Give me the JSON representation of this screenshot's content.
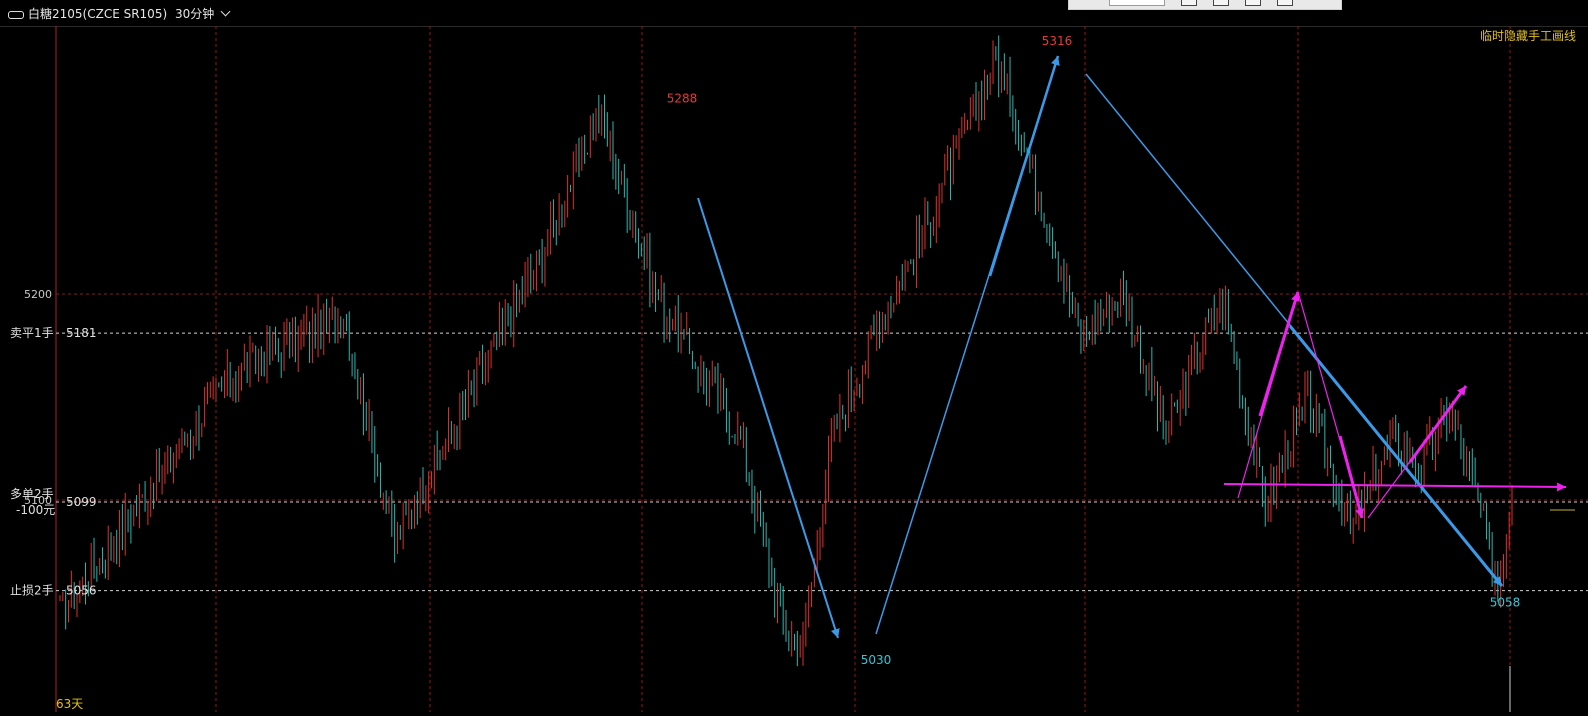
{
  "header": {
    "link_icon": "link-icon",
    "symbol": "白糖2105(CZCE SR105)",
    "period": "30分钟"
  },
  "toolbar_overlay": {
    "hide_lines_label": "临时隐藏手工画线"
  },
  "footer": {
    "days_label": "63天"
  },
  "colors": {
    "background": "#000000",
    "up": "#e0302c",
    "down": "#2ab7b0",
    "grid": "#8b1a1a",
    "guide": "#cfcfcf",
    "blue_line": "#3b9ae8",
    "magenta_line": "#ee22ee",
    "high_label": "#e23a3a",
    "low_label": "#31c7d9",
    "yellow": "#e0c020"
  },
  "chart_data": {
    "type": "candlestick",
    "ylim": [
      5010,
      5340
    ],
    "price_gridlines": [
      {
        "label": "5200",
        "value": 5200
      },
      {
        "label": "5100",
        "value": 5100
      }
    ],
    "order_lines": [
      {
        "label": "卖平1手",
        "price_label": "5181",
        "value": 5181
      },
      {
        "label": "多单2手\n-100元",
        "price_label": "5099",
        "value": 5099
      },
      {
        "label": "止损2手",
        "price_label": "5056",
        "value": 5056
      }
    ],
    "extreme_labels": [
      {
        "text": "5288",
        "value": 5288,
        "kind": "high"
      },
      {
        "text": "5316",
        "value": 5316,
        "kind": "high"
      },
      {
        "text": "5030",
        "value": 5030,
        "kind": "low"
      },
      {
        "text": "5058",
        "value": 5058,
        "kind": "low"
      }
    ],
    "swing_points": [
      {
        "idx": 0,
        "price": 5045
      },
      {
        "idx": 60,
        "price": 5160
      },
      {
        "idx": 100,
        "price": 5190
      },
      {
        "idx": 118,
        "price": 5080
      },
      {
        "idx": 170,
        "price": 5220
      },
      {
        "idx": 190,
        "price": 5288
      },
      {
        "idx": 210,
        "price": 5200
      },
      {
        "idx": 225,
        "price": 5165
      },
      {
        "idx": 240,
        "price": 5130
      },
      {
        "idx": 255,
        "price": 5038
      },
      {
        "idx": 262,
        "price": 5030
      },
      {
        "idx": 272,
        "price": 5130
      },
      {
        "idx": 290,
        "price": 5190
      },
      {
        "idx": 305,
        "price": 5230
      },
      {
        "idx": 330,
        "price": 5316
      },
      {
        "idx": 345,
        "price": 5250
      },
      {
        "idx": 360,
        "price": 5180
      },
      {
        "idx": 375,
        "price": 5200
      },
      {
        "idx": 390,
        "price": 5130
      },
      {
        "idx": 400,
        "price": 5170
      },
      {
        "idx": 410,
        "price": 5198
      },
      {
        "idx": 425,
        "price": 5095
      },
      {
        "idx": 440,
        "price": 5150
      },
      {
        "idx": 455,
        "price": 5085
      },
      {
        "idx": 470,
        "price": 5130
      },
      {
        "idx": 480,
        "price": 5115
      },
      {
        "idx": 490,
        "price": 5145
      },
      {
        "idx": 500,
        "price": 5100
      },
      {
        "idx": 507,
        "price": 5058
      },
      {
        "idx": 512,
        "price": 5105
      }
    ]
  }
}
